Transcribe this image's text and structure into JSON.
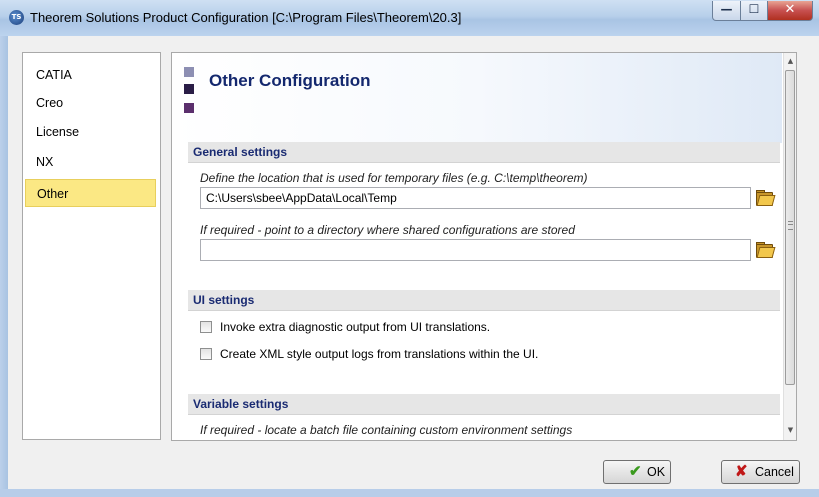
{
  "window": {
    "title": "Theorem Solutions Product Configuration [C:\\Program Files\\Theorem\\20.3]",
    "icon_text": "TS",
    "controls": {
      "minimize_icon": "minimize-icon",
      "maximize_icon": "maximize-icon",
      "close_icon": "close-icon"
    }
  },
  "sidebar": {
    "items": [
      {
        "label": "CATIA"
      },
      {
        "label": "Creo"
      },
      {
        "label": "License"
      },
      {
        "label": "NX"
      },
      {
        "label": "Other",
        "selected": true
      }
    ]
  },
  "page": {
    "title": "Other Configuration",
    "sections": {
      "general": {
        "header": "General settings",
        "temp_hint": "Define the location that is used for temporary files (e.g. C:\\temp\\theorem)",
        "temp_value": "C:\\Users\\sbee\\AppData\\Local\\Temp",
        "shared_hint": "If required - point to a directory where shared configurations are stored",
        "shared_value": ""
      },
      "ui": {
        "header": "UI settings",
        "options": [
          {
            "label": "Invoke extra diagnostic output from UI translations.",
            "checked": false
          },
          {
            "label": "Create XML style output logs from translations within the UI.",
            "checked": false
          }
        ]
      },
      "variable": {
        "header": "Variable settings",
        "batch_hint": "If required - locate a batch file containing custom environment settings"
      }
    }
  },
  "footer": {
    "ok_label": "OK",
    "cancel_label": "Cancel"
  },
  "colors": {
    "selection": "#fbe884",
    "section_title": "#1a2b72",
    "page_title": "#14286e",
    "ok_check": "#3a9a1e",
    "cancel_x": "#c01818"
  }
}
